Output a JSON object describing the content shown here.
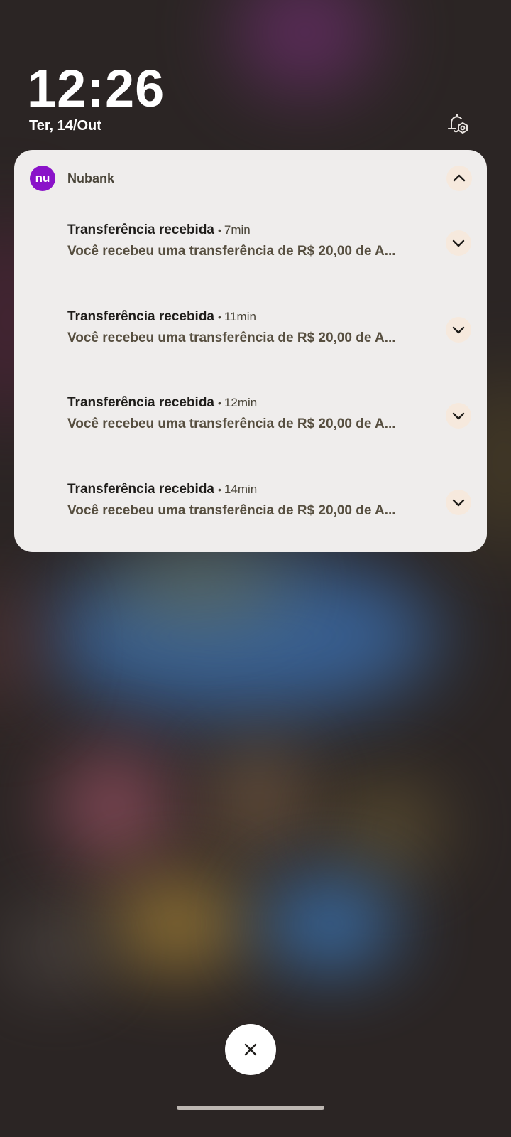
{
  "lockscreen": {
    "time": "12:26",
    "date": "Ter, 14/Out",
    "settings_icon": "notification-settings-icon"
  },
  "notification_group": {
    "app": {
      "name": "Nubank",
      "logo_text": "nu",
      "brand_color": "#8a13c9",
      "collapse_icon": "chevron-up-icon"
    },
    "items": [
      {
        "title": "Transferência recebida",
        "separator": "•",
        "time": "7min",
        "body": "Você recebeu uma transferência de R$ 20,00 de A...",
        "expand_icon": "chevron-down-icon"
      },
      {
        "title": "Transferência recebida",
        "separator": "•",
        "time": "11min",
        "body": "Você recebeu uma transferência de R$ 20,00 de A...",
        "expand_icon": "chevron-down-icon"
      },
      {
        "title": "Transferência recebida",
        "separator": "•",
        "time": "12min",
        "body": "Você recebeu uma transferência de R$ 20,00 de A...",
        "expand_icon": "chevron-down-icon"
      },
      {
        "title": "Transferência recebida",
        "separator": "•",
        "time": "14min",
        "body": "Você recebeu uma transferência de R$ 20,00 de A...",
        "expand_icon": "chevron-down-icon"
      }
    ]
  },
  "footer": {
    "clear_icon": "close-icon"
  }
}
